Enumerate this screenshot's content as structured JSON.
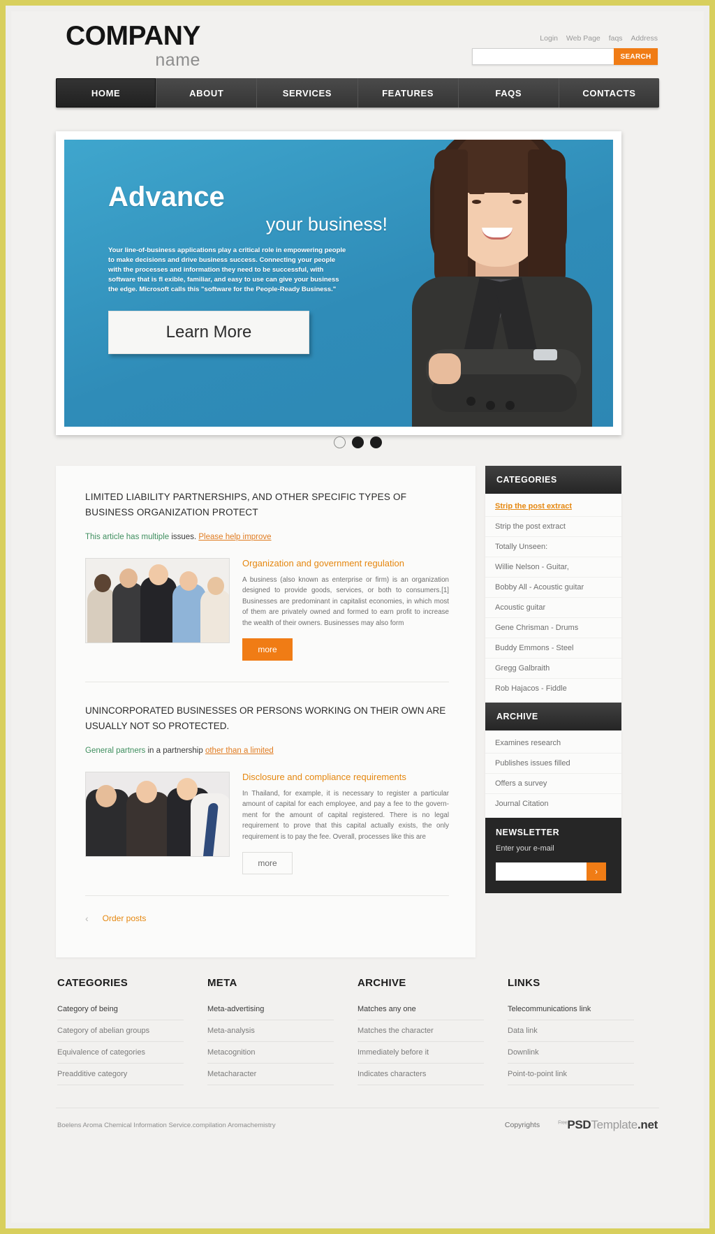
{
  "header": {
    "logo_company": "COMPANY",
    "logo_name": "name",
    "top_links": [
      "Login",
      "Web Page",
      "faqs",
      "Address"
    ],
    "search_value": "",
    "search_placeholder": "",
    "search_button": "SEARCH"
  },
  "nav": {
    "items": [
      {
        "label": "HOME",
        "active": true
      },
      {
        "label": "ABOUT",
        "active": false
      },
      {
        "label": "SERVICES",
        "active": false
      },
      {
        "label": "FEATURES",
        "active": false
      },
      {
        "label": "FAQS",
        "active": false
      },
      {
        "label": "CONTACTS",
        "active": false
      }
    ]
  },
  "slider": {
    "heading": "Advance",
    "subheading": "your business!",
    "paragraph": "Your line-of-business applications play a critical role in empowering people to make decisions and drive business success. Connecting your people with the processes and information they need to be successful, with software that is fl exible, familiar, and easy to use can give your business the edge. Microsoft calls this \"software for the People-Ready Business.\"",
    "button": "Learn More",
    "dots": [
      {
        "state": "off"
      },
      {
        "state": "on"
      },
      {
        "state": "on"
      }
    ]
  },
  "main": {
    "article1": {
      "title": "LIMITED LIABILITY PARTNERSHIPS, AND OTHER SPECIFIC TYPES OF BUSINESS ORGANIZATION PROTECT",
      "note_green": "This article has multiple",
      "note_plain": " issues. ",
      "note_link": "Please help improve",
      "heading": "Organization and government regulation",
      "body": "A business (also known as enterprise or firm) is an organization designed to provide goods, services, or both to consumers.[1] Businesses are predominant in capitalist economies, in which most of them are privately owned and formed to earn profit to increase the wealth of their owners. Businesses may also form",
      "more": "more"
    },
    "article2": {
      "title": "UNINCORPORATED BUSINESSES OR PERSONS WORKING ON THEIR OWN ARE USUALLY NOT SO PROTECTED.",
      "note_green": "General partners",
      "note_plain": " in a partnership ",
      "note_link": "other than a limited",
      "heading": "Disclosure and compliance requirements",
      "body": "In Thailand, for example, it is necessary to register a particular amount of capital for each employee, and pay a fee to the govern-ment for the amount of capital registered. There is no legal requirement to prove that this capital actually exists, the only requirement is to pay the fee. Overall, processes like this are",
      "more": "more"
    },
    "pager": {
      "arrow": "‹",
      "link": "Order posts"
    }
  },
  "sidebar": {
    "categories": {
      "title": "CATEGORIES",
      "items": [
        {
          "label": "Strip the post extract",
          "active": true
        },
        {
          "label": "Strip the post extract",
          "active": false
        },
        {
          "label": "Totally Unseen:",
          "active": false
        },
        {
          "label": "Willie Nelson - Guitar,",
          "active": false
        },
        {
          "label": "Bobby All - Acoustic guitar",
          "active": false
        },
        {
          "label": "Acoustic guitar",
          "active": false
        },
        {
          "label": "Gene Chrisman - Drums",
          "active": false
        },
        {
          "label": "Buddy Emmons - Steel",
          "active": false
        },
        {
          "label": "Gregg Galbraith",
          "active": false
        },
        {
          "label": "Rob Hajacos - Fiddle",
          "active": false
        }
      ]
    },
    "archive": {
      "title": "ARCHIVE",
      "items": [
        {
          "label": "Examines research"
        },
        {
          "label": "Publishes issues filled"
        },
        {
          "label": "Offers a survey"
        },
        {
          "label": "Journal Citation"
        }
      ]
    },
    "newsletter": {
      "title": "NEWSLETTER",
      "subtitle": "Enter your e-mail",
      "input_value": "",
      "input_placeholder": "",
      "button": "›"
    }
  },
  "footer": {
    "columns": [
      {
        "title": "CATEGORIES",
        "links": [
          "Category of being",
          "Category of abelian groups",
          "Equivalence of categories",
          "Preadditive category"
        ]
      },
      {
        "title": "META",
        "links": [
          "Meta-advertising",
          "Meta-analysis",
          "Metacognition",
          "Metacharacter"
        ]
      },
      {
        "title": "ARCHIVE",
        "links": [
          "Matches any one",
          "Matches the character",
          "Immediately before it",
          "Indicates characters"
        ]
      },
      {
        "title": "LINKS",
        "links": [
          "Telecommunications link",
          "Data link",
          "Downlink",
          "Point-to-point link"
        ]
      }
    ],
    "copyright_left": "Boelens Aroma Chemical Information Service.compilation Aromachemistry",
    "copyright_right": "Copyrights",
    "brand_free": "Free",
    "brand_psd": "PSD",
    "brand_template": "Template",
    "brand_net": ".net"
  },
  "colors": {
    "accent_orange": "#f07c15",
    "link_orange": "#e5870f",
    "nav_dark": "#343434",
    "frame_gold": "#d8cf5d",
    "hero_blue": "#2f8cb8"
  }
}
